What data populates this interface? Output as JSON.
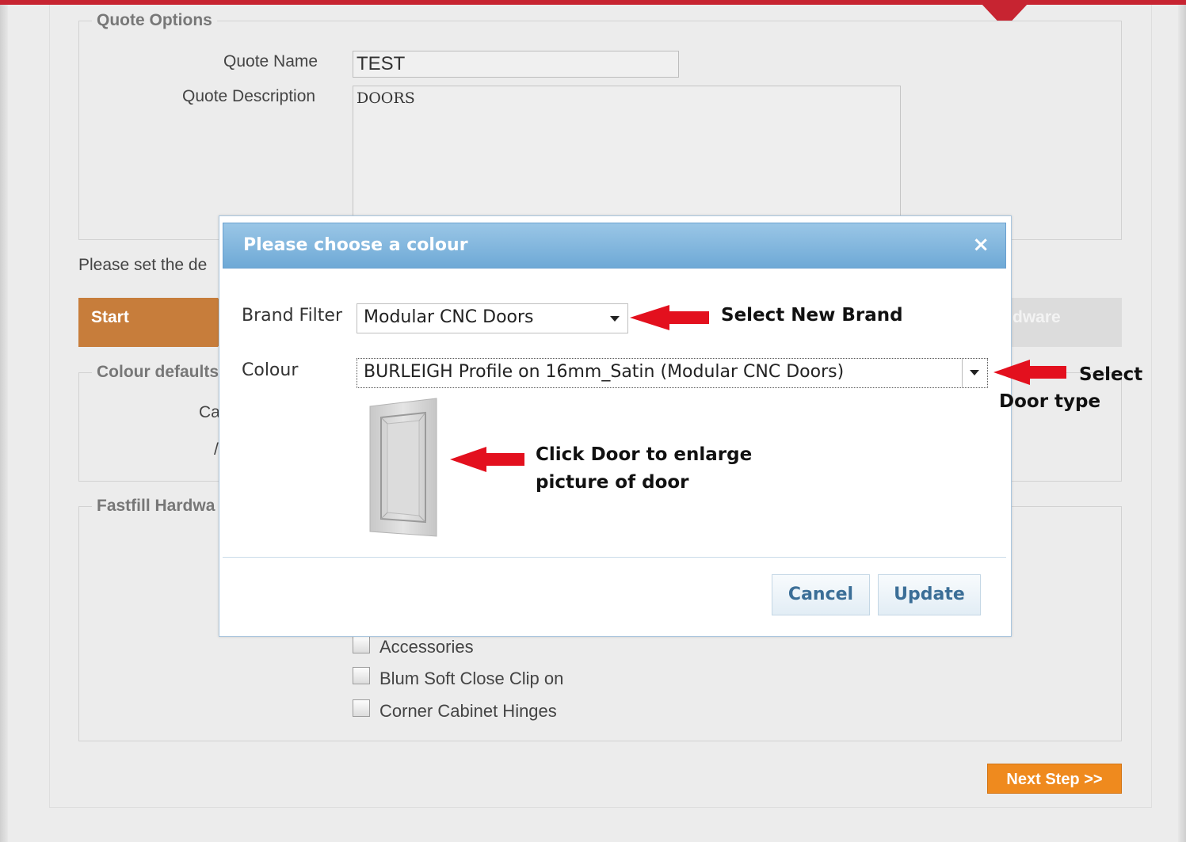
{
  "quote_options": {
    "legend": "Quote Options",
    "name_label": "Quote Name",
    "name_value": "TEST",
    "description_label": "Quote Description",
    "description_value": "DOORS"
  },
  "instructions_text": "Please set the de",
  "steps": {
    "start": "Start",
    "hardware_partial": "dware"
  },
  "colour_defaults": {
    "legend": "Colour defaults",
    "partial_label_1": "Ca",
    "partial_label_2": "/"
  },
  "fastfill": {
    "legend": "Fastfill Hardwa",
    "items": [
      {
        "label": "Accessories",
        "checked": false
      },
      {
        "label": "Blum Soft Close Clip on",
        "checked": false
      },
      {
        "label": "Corner Cabinet Hinges",
        "checked": false
      }
    ]
  },
  "next_step_label": "Next Step >>",
  "dialog": {
    "title": "Please choose a colour",
    "close_glyph": "×",
    "brand_filter_label": "Brand Filter",
    "brand_filter_value": "Modular CNC Doors",
    "colour_label": "Colour",
    "colour_value": "BURLEIGH Profile on 16mm_Satin (Modular CNC Doors)",
    "cancel_label": "Cancel",
    "update_label": "Update"
  },
  "annotations": {
    "brand": "Select New Brand",
    "door_type_line1": "Select",
    "door_type_line2": "Door type",
    "click_line1": "Click Door to enlarge",
    "click_line2": "picture of door"
  },
  "colors": {
    "top_bar": "#c72431",
    "start_step": "#c77d3b",
    "next_button": "#ef8a1e",
    "dialog_header": "#7fb4dd",
    "arrow": "#e3101e"
  },
  "icons": {
    "close": "close-icon",
    "arrow": "red-arrow-icon",
    "dropdown": "chevron-down-icon"
  }
}
